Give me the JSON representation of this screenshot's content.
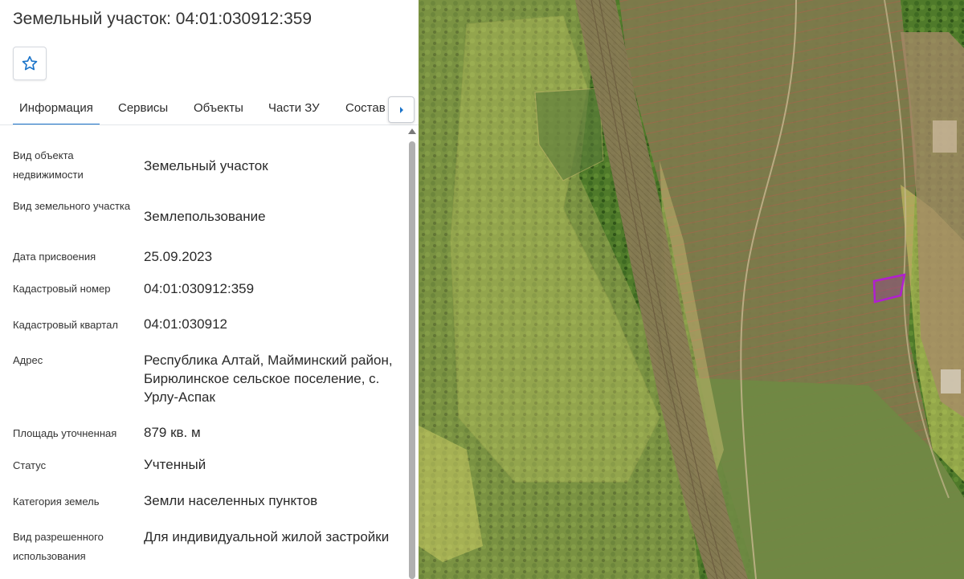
{
  "header": {
    "title": "Земельный участок: 04:01:030912:359"
  },
  "tabs": [
    {
      "label": "Информация",
      "active": true
    },
    {
      "label": "Сервисы",
      "active": false
    },
    {
      "label": "Объекты",
      "active": false
    },
    {
      "label": "Части ЗУ",
      "active": false
    },
    {
      "label": "Состав",
      "active": false
    }
  ],
  "properties": [
    {
      "label": "Вид объекта недвижимости",
      "value": "Земельный участок"
    },
    {
      "label": "Вид земельного участка",
      "value": "Землепользование"
    },
    {
      "label": "Дата присвоения",
      "value": "25.09.2023"
    },
    {
      "label": "Кадастровый номер",
      "value": "04:01:030912:359"
    },
    {
      "label": "Кадастровый квартал",
      "value": "04:01:030912"
    },
    {
      "label": "Адрес",
      "value": "Республика Алтай, Майминский район, Бирюлинское сельское поселение, с. Урлу-Аспак"
    },
    {
      "label": "Площадь уточненная",
      "value": "879 кв. м"
    },
    {
      "label": "Статус",
      "value": "Учтенный"
    },
    {
      "label": "Категория земель",
      "value": "Земли населенных пунктов"
    },
    {
      "label": "Вид разрешенного использования",
      "value": "Для индивидуальной жилой застройки"
    }
  ],
  "icons": {
    "favorite": "star-outline-icon",
    "tab_scroll": "chevron-right-icon"
  },
  "colors": {
    "accent": "#1a73c9",
    "parcel_highlight": "#a020c0",
    "zone_overlay": "#e8d080"
  }
}
